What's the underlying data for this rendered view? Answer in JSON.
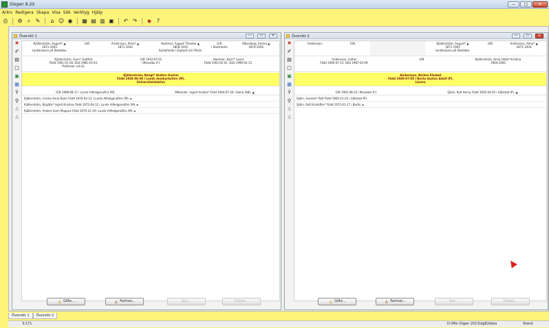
{
  "app": {
    "title": "Disgen 8.2d"
  },
  "window_controls": {
    "minimize": "—",
    "maximize": "□",
    "close": "✕"
  },
  "menu": [
    "Arkiv",
    "Redigera",
    "Skapa",
    "Visa",
    "Sök",
    "Verktyg",
    "Hjälp"
  ],
  "toolbar_icons": [
    "printer-icon",
    "tools-icon",
    "search-icon",
    "edit-icon",
    "home-icon",
    "people-icon",
    "view-icon",
    "grid-icon",
    "layout-icon",
    "undo-icon",
    "color-icon",
    "help-icon"
  ],
  "left": {
    "title": "Översikt 1",
    "pane_controls": {
      "minimize": "—",
      "restore": "▭",
      "close": "✕"
    },
    "grandparents": [
      {
        "name": "Kjällerström, August* ▲",
        "years": "1871-1945",
        "occupation": "Lantbrukare på Stadiebo."
      },
      {
        "name": "Gift.",
        "years": "",
        "occupation": ""
      },
      {
        "name": "Andersson, Alma* ▲",
        "years": "1871-1934",
        "occupation": ""
      },
      {
        "name": "Hammar, August Theodor ▲",
        "years": "1858-1916",
        "occupation": "Kyrkoherde i Esphult och Åhsäl"
      },
      {
        "name": "Gift.",
        "years": "i Stockholm.",
        "occupation": ""
      },
      {
        "name": "Hökerberg, Emma ▲",
        "years": "1870-1956",
        "occupation": ""
      }
    ],
    "parents": [
      {
        "name": "Kjällerström, Sven* Gottfrid",
        "info": "Född 1901-01-28. Död 1981-03-03.",
        "occupation": "Professor vid LU."
      },
      {
        "name": "Gift 1932-07-01",
        "info": "i Mossebo (F).",
        "occupation": ""
      },
      {
        "name": "Hammar, Karin* Laura",
        "info": "Född 1903-02-01. Död 1999-02-15.",
        "occupation": ""
      }
    ],
    "main": {
      "name": "Kjällerström, Bengt* Anders Gustav",
      "born": "Född 1938-06-06 i Lunds domkyrkoförs (M).",
      "occupation": "Universitetslektor."
    },
    "marriage": {
      "left": "Gift 1968-08-17 i Lunds Allhelgonaförs (M).",
      "right": "Melander, Ingrid Annika* Född 1944-07-26 i Solna (AB). ▲"
    },
    "children": [
      "Kjällerström, Cecilia Anna Karin Född 1970-02-13 i Lunds Allhelgonaförs (M). ►",
      "Kjällerström, Birgitta* Ingrid Kristina Född 1972-04-12 i Lunds Allhelgonaförs (M). ►",
      "Kjällerström, Anders Sven Magnus Född 1975-12-19 i Lunds Allhelgonaförs (M). ►"
    ],
    "buttons": {
      "gifte": "Gifte...",
      "partner": "Partner...",
      "son": "Son...",
      "dotter": "Dotter..."
    }
  },
  "right": {
    "title": "Översikt 2",
    "pane_controls": {
      "minimize": "—",
      "restore": "▭",
      "close": "✕"
    },
    "grandparents": [
      {
        "name": "Andersson,",
        "years": "",
        "occupation": ""
      },
      {
        "name": "Gift.",
        "years": "",
        "occupation": ""
      },
      {
        "name": "",
        "years": "",
        "occupation": ""
      },
      {
        "name": "Kjällerström, August* ▲",
        "years": "1871-1945",
        "occupation": "Lantbrukare på Stadiebo."
      },
      {
        "name": "Gift.",
        "years": "",
        "occupation": ""
      },
      {
        "name": "Andersson, Alma* ▲",
        "years": "1871-1934",
        "occupation": ""
      }
    ],
    "parents": [
      {
        "name": "Andersson, Luther",
        "info": "Född 1900-07-15. Död 1987-02-09.",
        "occupation": ""
      },
      {
        "name": "Gift",
        "info": "",
        "occupation": ""
      },
      {
        "name": "Kjällerström, Anna Hilda* Kristina",
        "info": "1904-2000",
        "occupation": ""
      }
    ],
    "main": {
      "name": "Andersson, Barbro Elsabet",
      "born": "Född 1940-07-05 i Borås Gustav Adolf (P).",
      "occupation": "Lärare."
    },
    "marriage": {
      "left": "Gift 1961-08-24 i Mossebo (F).",
      "right": "Sjölin, Rolf Henry Född 1935-04-05 i Gällstad (P). ▲"
    },
    "children": [
      "Sjölin, Sverker* Rolf Född 1965-12-25 i Gällstad (P).",
      "Sjölin, Rolf Kristoffer* Född 1971-01-17 i Borås. ►"
    ],
    "buttons": {
      "gifte": "Gifte...",
      "partner": "Partner...",
      "son": "Son...",
      "dotter": "Dotter..."
    }
  },
  "tabs": [
    "Översikt 1",
    "Översikt 2"
  ],
  "status": {
    "count": "3:171",
    "path": "D:\\Min Digen 2013\\dg82data",
    "mode": "Stand"
  },
  "colors": {
    "background": "#fdf57a",
    "highlight": "#ffff66",
    "close": "#d04a3a"
  }
}
